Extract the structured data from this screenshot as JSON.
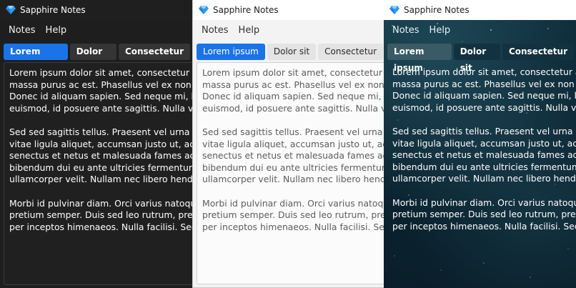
{
  "app": {
    "title": "Sapphire Notes"
  },
  "menu": {
    "notes": "Notes",
    "help": "Help"
  },
  "tabs": [
    {
      "label": "Lorem ipsum",
      "active": true
    },
    {
      "label": "Dolor sit",
      "active": false
    },
    {
      "label": "Consectetur",
      "active": false
    }
  ],
  "document": {
    "paragraphs": [
      [
        "Lorem ipsum dolor sit amet, consectetur adipiscing elit.",
        "massa purus ac est. Phasellus vel ex non sapien",
        "Donec id aliquam sapien. Sed neque mi, lobortis",
        "euismod, id posuere ante sagittis. Nulla venenatis"
      ],
      [
        "Sed sed sagittis tellus. Praesent vel urna non eros",
        "vitae ligula aliquet, accumsan justo ut, accumsan",
        "senectus et netus et malesuada fames ac turpis",
        "bibendum dui eu ante ultricies fermentum. Cum",
        "ullamcorper velit. Nullam nec libero hendrerit,"
      ],
      [
        "Morbi id pulvinar diam. Orci varius natoque penatibus",
        "pretium semper. Duis sed leo rutrum, pretium",
        "per inceptos himenaeos. Nulla facilisi. Sed sagittis"
      ]
    ]
  },
  "themes": {
    "dark": {
      "accent": "#1a73e8",
      "background": "#1e1e1e"
    },
    "light": {
      "accent": "#1a73e8",
      "background": "#f3f3f3"
    },
    "starry": {
      "accent": "#3a5a66",
      "background": "#0b2330"
    }
  },
  "icons": {
    "app": "sapphire-gem-icon"
  }
}
